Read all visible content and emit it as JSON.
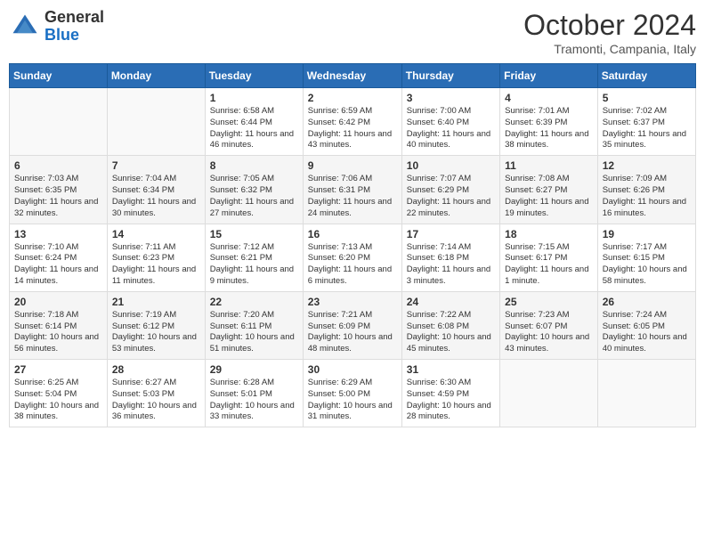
{
  "header": {
    "logo": {
      "general": "General",
      "blue": "Blue"
    },
    "title": "October 2024",
    "location": "Tramonti, Campania, Italy"
  },
  "calendar": {
    "days_of_week": [
      "Sunday",
      "Monday",
      "Tuesday",
      "Wednesday",
      "Thursday",
      "Friday",
      "Saturday"
    ],
    "weeks": [
      [
        {
          "day": "",
          "sunrise": "",
          "sunset": "",
          "daylight": ""
        },
        {
          "day": "",
          "sunrise": "",
          "sunset": "",
          "daylight": ""
        },
        {
          "day": "1",
          "sunrise": "Sunrise: 6:58 AM",
          "sunset": "Sunset: 6:44 PM",
          "daylight": "Daylight: 11 hours and 46 minutes."
        },
        {
          "day": "2",
          "sunrise": "Sunrise: 6:59 AM",
          "sunset": "Sunset: 6:42 PM",
          "daylight": "Daylight: 11 hours and 43 minutes."
        },
        {
          "day": "3",
          "sunrise": "Sunrise: 7:00 AM",
          "sunset": "Sunset: 6:40 PM",
          "daylight": "Daylight: 11 hours and 40 minutes."
        },
        {
          "day": "4",
          "sunrise": "Sunrise: 7:01 AM",
          "sunset": "Sunset: 6:39 PM",
          "daylight": "Daylight: 11 hours and 38 minutes."
        },
        {
          "day": "5",
          "sunrise": "Sunrise: 7:02 AM",
          "sunset": "Sunset: 6:37 PM",
          "daylight": "Daylight: 11 hours and 35 minutes."
        }
      ],
      [
        {
          "day": "6",
          "sunrise": "Sunrise: 7:03 AM",
          "sunset": "Sunset: 6:35 PM",
          "daylight": "Daylight: 11 hours and 32 minutes."
        },
        {
          "day": "7",
          "sunrise": "Sunrise: 7:04 AM",
          "sunset": "Sunset: 6:34 PM",
          "daylight": "Daylight: 11 hours and 30 minutes."
        },
        {
          "day": "8",
          "sunrise": "Sunrise: 7:05 AM",
          "sunset": "Sunset: 6:32 PM",
          "daylight": "Daylight: 11 hours and 27 minutes."
        },
        {
          "day": "9",
          "sunrise": "Sunrise: 7:06 AM",
          "sunset": "Sunset: 6:31 PM",
          "daylight": "Daylight: 11 hours and 24 minutes."
        },
        {
          "day": "10",
          "sunrise": "Sunrise: 7:07 AM",
          "sunset": "Sunset: 6:29 PM",
          "daylight": "Daylight: 11 hours and 22 minutes."
        },
        {
          "day": "11",
          "sunrise": "Sunrise: 7:08 AM",
          "sunset": "Sunset: 6:27 PM",
          "daylight": "Daylight: 11 hours and 19 minutes."
        },
        {
          "day": "12",
          "sunrise": "Sunrise: 7:09 AM",
          "sunset": "Sunset: 6:26 PM",
          "daylight": "Daylight: 11 hours and 16 minutes."
        }
      ],
      [
        {
          "day": "13",
          "sunrise": "Sunrise: 7:10 AM",
          "sunset": "Sunset: 6:24 PM",
          "daylight": "Daylight: 11 hours and 14 minutes."
        },
        {
          "day": "14",
          "sunrise": "Sunrise: 7:11 AM",
          "sunset": "Sunset: 6:23 PM",
          "daylight": "Daylight: 11 hours and 11 minutes."
        },
        {
          "day": "15",
          "sunrise": "Sunrise: 7:12 AM",
          "sunset": "Sunset: 6:21 PM",
          "daylight": "Daylight: 11 hours and 9 minutes."
        },
        {
          "day": "16",
          "sunrise": "Sunrise: 7:13 AM",
          "sunset": "Sunset: 6:20 PM",
          "daylight": "Daylight: 11 hours and 6 minutes."
        },
        {
          "day": "17",
          "sunrise": "Sunrise: 7:14 AM",
          "sunset": "Sunset: 6:18 PM",
          "daylight": "Daylight: 11 hours and 3 minutes."
        },
        {
          "day": "18",
          "sunrise": "Sunrise: 7:15 AM",
          "sunset": "Sunset: 6:17 PM",
          "daylight": "Daylight: 11 hours and 1 minute."
        },
        {
          "day": "19",
          "sunrise": "Sunrise: 7:17 AM",
          "sunset": "Sunset: 6:15 PM",
          "daylight": "Daylight: 10 hours and 58 minutes."
        }
      ],
      [
        {
          "day": "20",
          "sunrise": "Sunrise: 7:18 AM",
          "sunset": "Sunset: 6:14 PM",
          "daylight": "Daylight: 10 hours and 56 minutes."
        },
        {
          "day": "21",
          "sunrise": "Sunrise: 7:19 AM",
          "sunset": "Sunset: 6:12 PM",
          "daylight": "Daylight: 10 hours and 53 minutes."
        },
        {
          "day": "22",
          "sunrise": "Sunrise: 7:20 AM",
          "sunset": "Sunset: 6:11 PM",
          "daylight": "Daylight: 10 hours and 51 minutes."
        },
        {
          "day": "23",
          "sunrise": "Sunrise: 7:21 AM",
          "sunset": "Sunset: 6:09 PM",
          "daylight": "Daylight: 10 hours and 48 minutes."
        },
        {
          "day": "24",
          "sunrise": "Sunrise: 7:22 AM",
          "sunset": "Sunset: 6:08 PM",
          "daylight": "Daylight: 10 hours and 45 minutes."
        },
        {
          "day": "25",
          "sunrise": "Sunrise: 7:23 AM",
          "sunset": "Sunset: 6:07 PM",
          "daylight": "Daylight: 10 hours and 43 minutes."
        },
        {
          "day": "26",
          "sunrise": "Sunrise: 7:24 AM",
          "sunset": "Sunset: 6:05 PM",
          "daylight": "Daylight: 10 hours and 40 minutes."
        }
      ],
      [
        {
          "day": "27",
          "sunrise": "Sunrise: 6:25 AM",
          "sunset": "Sunset: 5:04 PM",
          "daylight": "Daylight: 10 hours and 38 minutes."
        },
        {
          "day": "28",
          "sunrise": "Sunrise: 6:27 AM",
          "sunset": "Sunset: 5:03 PM",
          "daylight": "Daylight: 10 hours and 36 minutes."
        },
        {
          "day": "29",
          "sunrise": "Sunrise: 6:28 AM",
          "sunset": "Sunset: 5:01 PM",
          "daylight": "Daylight: 10 hours and 33 minutes."
        },
        {
          "day": "30",
          "sunrise": "Sunrise: 6:29 AM",
          "sunset": "Sunset: 5:00 PM",
          "daylight": "Daylight: 10 hours and 31 minutes."
        },
        {
          "day": "31",
          "sunrise": "Sunrise: 6:30 AM",
          "sunset": "Sunset: 4:59 PM",
          "daylight": "Daylight: 10 hours and 28 minutes."
        },
        {
          "day": "",
          "sunrise": "",
          "sunset": "",
          "daylight": ""
        },
        {
          "day": "",
          "sunrise": "",
          "sunset": "",
          "daylight": ""
        }
      ]
    ]
  }
}
